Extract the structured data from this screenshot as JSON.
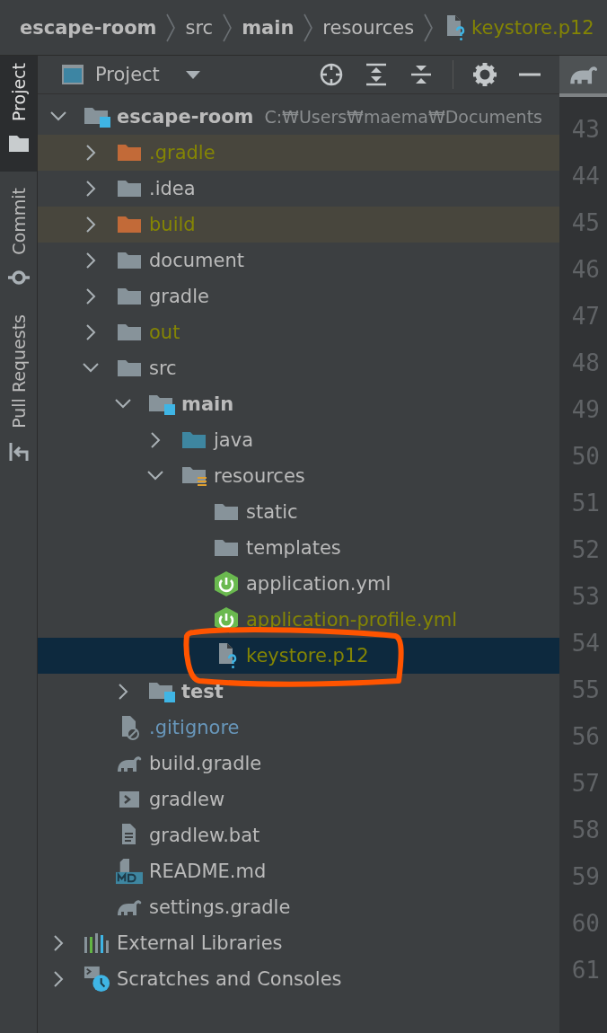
{
  "breadcrumb": [
    {
      "label": "escape-room",
      "kind": "module",
      "color": "#bbbbbb"
    },
    {
      "label": "src",
      "kind": "folder",
      "color": "#bbbbbb"
    },
    {
      "label": "main",
      "kind": "module",
      "color": "#bbbbbb"
    },
    {
      "label": "resources",
      "kind": "folder",
      "color": "#bbbbbb"
    },
    {
      "label": "keystore.p12",
      "kind": "unknown-file",
      "color": "#848504"
    }
  ],
  "sidebar_tabs": [
    {
      "label": "Project",
      "kind": "project",
      "selected": true
    },
    {
      "label": "Commit",
      "kind": "commit",
      "selected": false
    },
    {
      "label": "Pull Requests",
      "kind": "pull-requests",
      "selected": false
    }
  ],
  "toolbar": {
    "view_label": "Project"
  },
  "tree": [
    {
      "label": "escape-room",
      "path": "C:₩Users₩maema₩Documents",
      "kind": "module",
      "color": "#bbbbbb",
      "excluded": false,
      "selected": false,
      "expanded": true,
      "children": [
        {
          "label": ".gradle",
          "kind": "folder",
          "color": "#848504",
          "excluded": true,
          "selected": false,
          "expanded": false
        },
        {
          "label": ".idea",
          "kind": "folder",
          "color": "#bbbbbb",
          "excluded": false,
          "selected": false,
          "expanded": false
        },
        {
          "label": "build",
          "kind": "folder",
          "color": "#848504",
          "excluded": true,
          "selected": false,
          "expanded": false
        },
        {
          "label": "document",
          "kind": "folder",
          "color": "#bbbbbb",
          "excluded": false,
          "selected": false,
          "expanded": false
        },
        {
          "label": "gradle",
          "kind": "folder",
          "color": "#bbbbbb",
          "excluded": false,
          "selected": false,
          "expanded": false
        },
        {
          "label": "out",
          "kind": "folder",
          "color": "#848504",
          "excluded": false,
          "selected": false,
          "expanded": false
        },
        {
          "label": "src",
          "kind": "folder",
          "color": "#bbbbbb",
          "excluded": false,
          "selected": false,
          "expanded": true,
          "children": [
            {
              "label": "main",
              "kind": "module",
              "color": "#bbbbbb",
              "excluded": false,
              "selected": false,
              "expanded": true,
              "children": [
                {
                  "label": "java",
                  "kind": "source-folder",
                  "color": "#bbbbbb",
                  "excluded": false,
                  "selected": false,
                  "expanded": false
                },
                {
                  "label": "resources",
                  "kind": "resources-folder",
                  "color": "#bbbbbb",
                  "excluded": false,
                  "selected": false,
                  "expanded": true,
                  "children": [
                    {
                      "label": "static",
                      "kind": "folder",
                      "color": "#bbbbbb",
                      "excluded": false,
                      "selected": false
                    },
                    {
                      "label": "templates",
                      "kind": "folder",
                      "color": "#bbbbbb",
                      "excluded": false,
                      "selected": false
                    },
                    {
                      "label": "application.yml",
                      "kind": "spring",
                      "color": "#bbbbbb",
                      "excluded": false,
                      "selected": false
                    },
                    {
                      "label": "application-profile.yml",
                      "kind": "spring",
                      "color": "#848504",
                      "excluded": false,
                      "selected": false
                    },
                    {
                      "label": "keystore.p12",
                      "kind": "unknown-file",
                      "color": "#848504",
                      "excluded": false,
                      "selected": true,
                      "circled": true
                    }
                  ]
                }
              ]
            },
            {
              "label": "test",
              "kind": "module",
              "color": "#bbbbbb",
              "excluded": false,
              "selected": false,
              "expanded": false
            }
          ]
        },
        {
          "label": ".gitignore",
          "kind": "ignore-file",
          "color": "#6897bb",
          "excluded": false,
          "selected": false
        },
        {
          "label": "build.gradle",
          "kind": "gradle",
          "color": "#bbbbbb",
          "excluded": false,
          "selected": false
        },
        {
          "label": "gradlew",
          "kind": "shell",
          "color": "#bbbbbb",
          "excluded": false,
          "selected": false
        },
        {
          "label": "gradlew.bat",
          "kind": "text",
          "color": "#bbbbbb",
          "excluded": false,
          "selected": false
        },
        {
          "label": "README.md",
          "kind": "markdown",
          "color": "#bbbbbb",
          "excluded": false,
          "selected": false
        },
        {
          "label": "settings.gradle",
          "kind": "gradle",
          "color": "#bbbbbb",
          "excluded": false,
          "selected": false
        }
      ]
    },
    {
      "label": "External Libraries",
      "kind": "libraries",
      "color": "#bbbbbb",
      "excluded": false,
      "selected": false,
      "expanded": false
    },
    {
      "label": "Scratches and Consoles",
      "kind": "scratches",
      "color": "#bbbbbb",
      "excluded": false,
      "selected": false,
      "expanded": false
    }
  ],
  "line_numbers": [
    "43",
    "44",
    "45",
    "46",
    "47",
    "48",
    "49",
    "50",
    "51",
    "52",
    "53",
    "54",
    "55",
    "56",
    "57",
    "58",
    "59",
    "60",
    "61"
  ]
}
